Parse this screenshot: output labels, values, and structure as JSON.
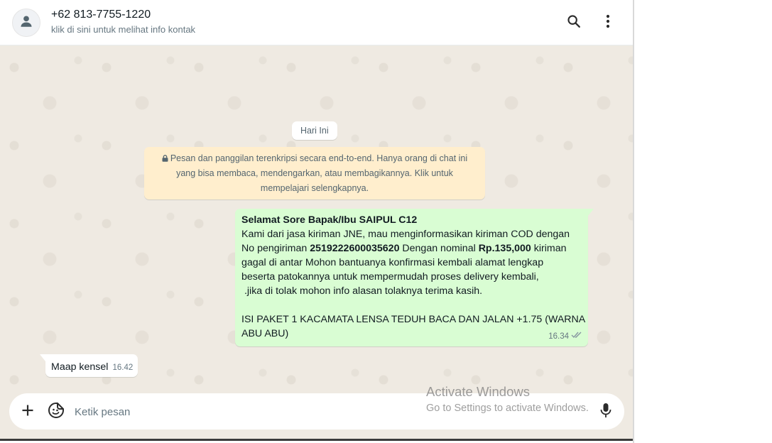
{
  "header": {
    "contact_name": "+62 813-7755-1220",
    "contact_subtitle": "klik di sini untuk melihat info kontak",
    "avatar_icon": "person-icon",
    "search_icon": "search-icon",
    "menu_icon": "more-vertical-icon"
  },
  "chat": {
    "date_chip": "Hari Ini",
    "encryption_notice": {
      "icon": "lock-icon",
      "line1": "Pesan dan panggilan terenkripsi secara end-to-end. Hanya orang di chat ini",
      "line2": "yang bisa membaca, mendengarkan, atau membagikannya. Klik untuk",
      "line3": "mempelajari selengkapnya."
    },
    "outgoing_message": {
      "greeting": "Selamat Sore Bapak/Ibu SAIPUL C12",
      "line1": "Kami dari jasa kiriman JNE, mau menginformasikan kiriman COD dengan",
      "line2_a": "No pengiriman ",
      "tracking_number": "2519222600035620",
      "line2_b": " Dengan nominal ",
      "amount": "Rp.135,000",
      "line2_c": " kiriman",
      "line3": "gagal di antar Mohon bantuanya konfirmasi kembali alamat lengkap",
      "line4": "beserta patokannya untuk mempermudah proses delivery kembali,",
      "line5": " .jika di tolak mohon info alasan tolaknya terima kasih.",
      "line6": "ISI PAKET 1 KACAMATA LENSA TEDUH BACA DAN JALAN +1.75 (WARNA",
      "line7": "ABU ABU)",
      "time": "16.34",
      "status_icon": "double-check-icon"
    },
    "incoming_message": {
      "text": "Maap kensel",
      "time": "16.42"
    }
  },
  "composer": {
    "attach_icon": "plus-icon",
    "sticker_icon": "sticker-icon",
    "placeholder": "Ketik pesan",
    "mic_icon": "mic-icon"
  },
  "watermark": {
    "title": "Activate Windows",
    "subtitle": "Go to Settings to activate Windows."
  },
  "colors": {
    "outgoing_bubble": "#d9fdd3",
    "incoming_bubble": "#ffffff",
    "encryption_notice_bg": "#ffeecd",
    "chat_background": "#efeae2"
  }
}
